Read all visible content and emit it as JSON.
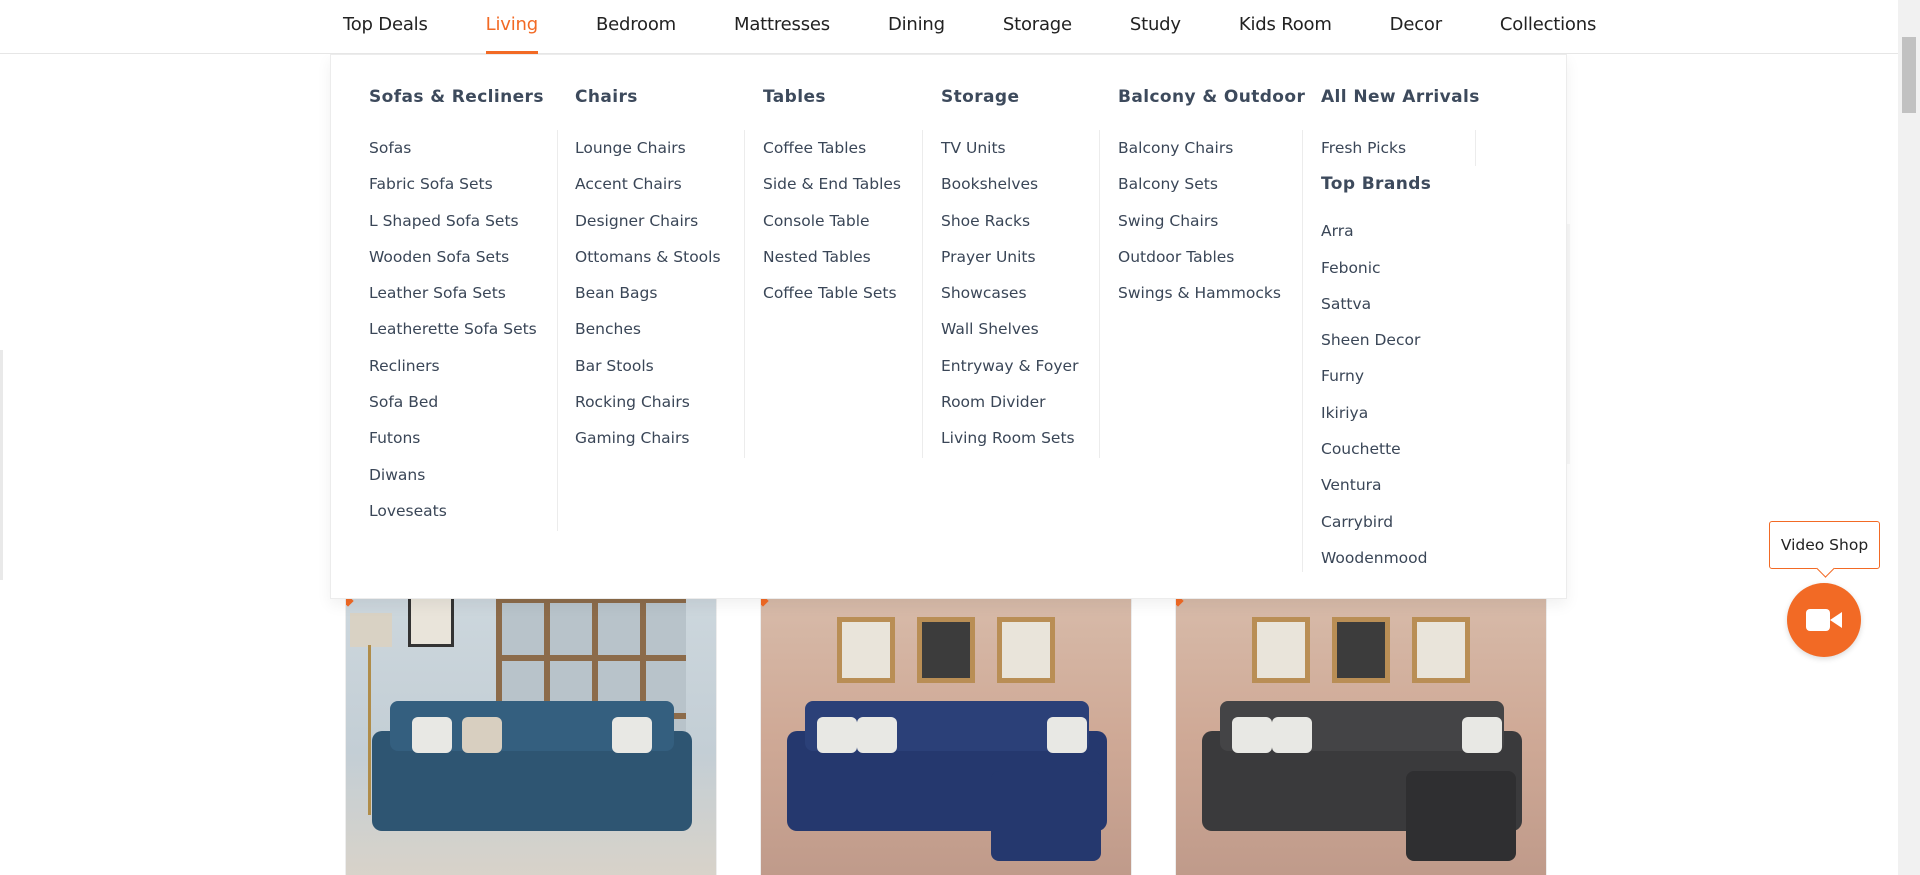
{
  "nav": {
    "items": [
      {
        "label": "Top Deals"
      },
      {
        "label": "Living",
        "active": true
      },
      {
        "label": "Bedroom"
      },
      {
        "label": "Mattresses"
      },
      {
        "label": "Dining"
      },
      {
        "label": "Storage"
      },
      {
        "label": "Study"
      },
      {
        "label": "Kids Room"
      },
      {
        "label": "Decor"
      },
      {
        "label": "Collections"
      }
    ]
  },
  "menu": {
    "sofas": {
      "title": "Sofas & Recliners",
      "items": [
        "Sofas",
        "Fabric Sofa Sets",
        "L Shaped Sofa Sets",
        "Wooden Sofa Sets",
        "Leather Sofa Sets",
        "Leatherette Sofa Sets",
        "Recliners",
        "Sofa Bed",
        "Futons",
        "Diwans",
        "Loveseats"
      ]
    },
    "chairs": {
      "title": "Chairs",
      "items": [
        "Lounge Chairs",
        "Accent Chairs",
        "Designer Chairs",
        "Ottomans & Stools",
        "Bean Bags",
        "Benches",
        "Bar Stools",
        "Rocking Chairs",
        "Gaming Chairs"
      ]
    },
    "tables": {
      "title": "Tables",
      "items": [
        "Coffee Tables",
        "Side & End Tables",
        "Console Table",
        "Nested Tables",
        "Coffee Table Sets"
      ]
    },
    "storage": {
      "title": "Storage",
      "items": [
        "TV Units",
        "Bookshelves",
        "Shoe Racks",
        "Prayer Units",
        "Showcases",
        "Wall Shelves",
        "Entryway & Foyer",
        "Room Divider",
        "Living Room Sets"
      ]
    },
    "balcony": {
      "title": "Balcony & Outdoor",
      "items": [
        "Balcony Chairs",
        "Balcony Sets",
        "Swing Chairs",
        "Outdoor Tables",
        "Swings & Hammocks"
      ]
    },
    "arrivals": {
      "title": "All New Arrivals",
      "items": [
        "Fresh Picks"
      ]
    },
    "brands": {
      "title": "Top Brands",
      "items": [
        "Arra",
        "Febonic",
        "Sattva",
        "Sheen Decor",
        "Furny",
        "Ikiriya",
        "Couchette",
        "Ventura",
        "Carrybird",
        "Woodenmood"
      ]
    }
  },
  "video_shop": {
    "label": "Video Shop",
    "icon": "video-camera-icon"
  },
  "colors": {
    "accent": "#f26a25",
    "menu_text": "#3a4657"
  }
}
